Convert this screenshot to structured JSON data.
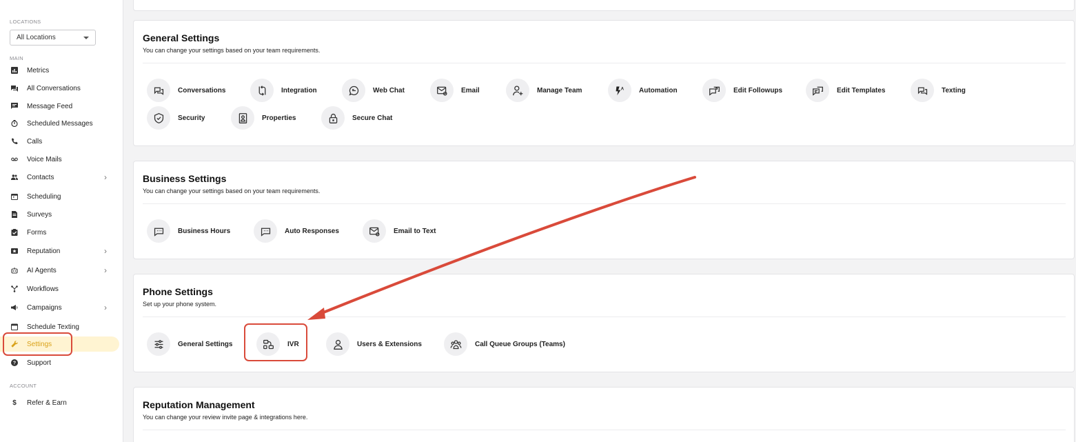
{
  "sidebar": {
    "locations_label": "LOCATIONS",
    "location_select": "All Locations",
    "main_label": "MAIN",
    "items": [
      {
        "label": "Metrics",
        "icon": "metrics-icon"
      },
      {
        "label": "All Conversations",
        "icon": "conversations-icon"
      },
      {
        "label": "Message Feed",
        "icon": "message-feed-icon"
      },
      {
        "label": "Scheduled Messages",
        "icon": "timer-icon"
      },
      {
        "label": "Calls",
        "icon": "phone-icon"
      },
      {
        "label": "Voice Mails",
        "icon": "voicemail-icon"
      },
      {
        "label": "Contacts",
        "icon": "contacts-icon"
      },
      {
        "label": "Scheduling",
        "icon": "calendar-icon"
      },
      {
        "label": "Surveys",
        "icon": "survey-icon"
      },
      {
        "label": "Forms",
        "icon": "form-icon"
      },
      {
        "label": "Reputation",
        "icon": "reputation-icon"
      },
      {
        "label": "AI Agents",
        "icon": "robot-icon"
      },
      {
        "label": "Workflows",
        "icon": "workflow-icon"
      },
      {
        "label": "Campaigns",
        "icon": "megaphone-icon"
      },
      {
        "label": "Schedule Texting",
        "icon": "calendar-text-icon"
      },
      {
        "label": "Settings",
        "icon": "wrench-icon"
      },
      {
        "label": "Support",
        "icon": "help-icon"
      }
    ],
    "account_label": "ACCOUNT",
    "account_items": [
      {
        "label": "Refer & Earn",
        "icon": "dollar-icon"
      }
    ]
  },
  "general": {
    "title": "General Settings",
    "subtitle": "You can change your settings based on your team requirements.",
    "tiles": [
      {
        "label": "Conversations",
        "icon": "conversations-icon"
      },
      {
        "label": "Integration",
        "icon": "integration-icon"
      },
      {
        "label": "Web Chat",
        "icon": "web-chat-icon"
      },
      {
        "label": "Email",
        "icon": "email-icon"
      },
      {
        "label": "Manage Team",
        "icon": "add-user-icon"
      },
      {
        "label": "Automation",
        "icon": "automation-icon"
      },
      {
        "label": "Edit Followups",
        "icon": "followups-icon"
      },
      {
        "label": "Edit Templates",
        "icon": "templates-icon"
      },
      {
        "label": "Texting",
        "icon": "texting-icon"
      },
      {
        "label": "Security",
        "icon": "shield-icon"
      },
      {
        "label": "Properties",
        "icon": "properties-icon"
      },
      {
        "label": "Secure Chat",
        "icon": "lock-icon"
      }
    ]
  },
  "business": {
    "title": "Business Settings",
    "subtitle": "You can change your settings based on your team requirements.",
    "tiles": [
      {
        "label": "Business Hours",
        "icon": "business-hours-icon"
      },
      {
        "label": "Auto Responses",
        "icon": "auto-responses-icon"
      },
      {
        "label": "Email to Text",
        "icon": "email-to-text-icon"
      }
    ]
  },
  "phone": {
    "title": "Phone Settings",
    "subtitle": "Set up your phone system.",
    "tiles": [
      {
        "label": "General Settings",
        "icon": "sliders-icon"
      },
      {
        "label": "IVR",
        "icon": "ivr-icon"
      },
      {
        "label": "Users & Extensions",
        "icon": "user-icon"
      },
      {
        "label": "Call Queue Groups (Teams)",
        "icon": "group-icon"
      }
    ]
  },
  "reputation": {
    "title": "Reputation Management",
    "subtitle": "You can change your review invite page & integrations here."
  },
  "colors": {
    "accent": "#d9a21a",
    "active_bg": "#fff4d2",
    "annotation": "#d94a3a"
  }
}
